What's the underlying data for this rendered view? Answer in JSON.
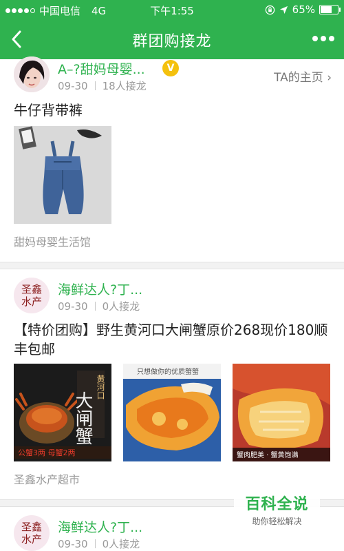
{
  "status_bar": {
    "carrier": "中国电信",
    "network": "4G",
    "time": "下午1:55",
    "battery_percent": "65%",
    "battery_level": 0.65,
    "signal_bars_filled": 4,
    "signal_bars_total": 5
  },
  "nav": {
    "title": "群团购接龙",
    "back_icon": "chevron-left-icon",
    "more_icon": "more-dots-icon"
  },
  "colors": {
    "brand_green": "#2fb24f",
    "vip_gold": "#f4c10e"
  },
  "posts": [
    {
      "author": "A–?甜妈母婴...",
      "badge": "V",
      "home_link": "TA的主页 ›",
      "date": "09-30",
      "participants": "18人接龙",
      "title": "牛仔背带裤",
      "shop": "甜妈母婴生活馆"
    },
    {
      "author": "海鲜达人?丁...",
      "avatar_text": "圣鑫水产",
      "date": "09-30",
      "participants": "0人接龙",
      "title": "【特价团购】野生黄河口大闸蟹原价268现价180顺丰包邮",
      "images": [
        {
          "vertical_text": "大闸蟹",
          "side_text": "黄河口",
          "caption": "公蟹3两 母蟹2两"
        },
        {
          "banner": "只想做你的优质蟹蟹"
        },
        {
          "caption": "蟹肉肥美 · 蟹黄饱满"
        }
      ],
      "shop": "圣鑫水产超市"
    },
    {
      "author": "海鲜达人?丁...",
      "avatar_text": "圣鑫水产",
      "date": "09-30",
      "participants": "0人接龙"
    }
  ],
  "watermark": {
    "title": "百科全说",
    "subtitle": "助你轻松解决"
  }
}
